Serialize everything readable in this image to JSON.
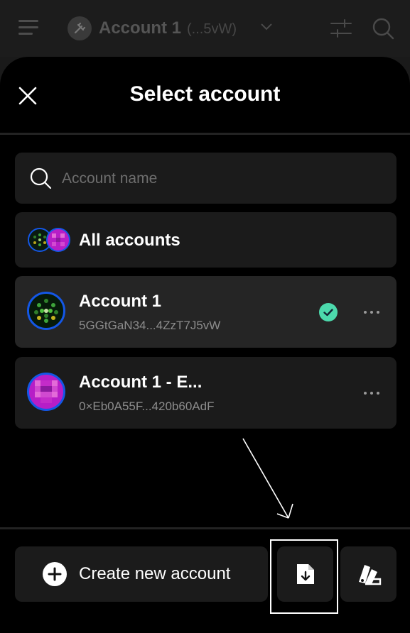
{
  "header": {
    "account_name": "Account 1",
    "account_short_address": "(...5vW)"
  },
  "modal": {
    "title": "Select account",
    "search": {
      "placeholder": "Account name",
      "value": ""
    },
    "all_accounts_label": "All accounts",
    "accounts": [
      {
        "name": "Account 1",
        "address": "5GGtGaN34...4ZzT7J5vW",
        "selected": true
      },
      {
        "name": "Account 1 - E...",
        "address": "0×Eb0A55F...420b60AdF",
        "selected": false
      }
    ],
    "create_label": "Create new account"
  },
  "colors": {
    "accent_blue": "#1457e6",
    "check_green": "#4cd9ac",
    "card_bg": "#1b1b1b",
    "selected_bg": "#252525"
  },
  "icons": {
    "menu": "hamburger-icon",
    "logo": "plug-icon",
    "chevron": "chevron-down-icon",
    "sliders": "sliders-icon",
    "search": "search-icon",
    "close": "close-icon",
    "more": "more-horizontal-icon",
    "selected": "check-circle-icon",
    "create": "plus-circle-icon",
    "import": "file-import-icon",
    "theme": "color-swatch-icon"
  }
}
